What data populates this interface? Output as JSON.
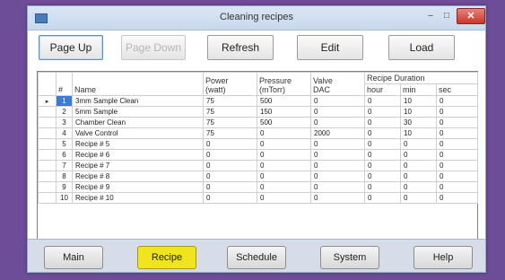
{
  "window": {
    "title": "Cleaning recipes",
    "minimize": "–",
    "maximize": "□",
    "close": "✕"
  },
  "toolbar": {
    "page_up": "Page Up",
    "page_down": "Page Down",
    "refresh": "Refresh",
    "edit": "Edit",
    "load": "Load"
  },
  "table": {
    "headers": {
      "num": "#",
      "name": "Name",
      "power": "Power",
      "power_unit": "(watt)",
      "pressure": "Pressure",
      "pressure_unit": "(mTorr)",
      "valve": "Valve",
      "valve_unit": "DAC",
      "duration": "Recipe Duration",
      "hour": "hour",
      "min": "min",
      "sec": "sec"
    },
    "current_row_marker": "▸",
    "rows": [
      {
        "num": "1",
        "name": "3mm Sample Clean",
        "power": "75",
        "pressure": "500",
        "valve": "0",
        "hour": "0",
        "min": "10",
        "sec": "0"
      },
      {
        "num": "2",
        "name": "5mm Sample",
        "power": "75",
        "pressure": "150",
        "valve": "0",
        "hour": "0",
        "min": "10",
        "sec": "0"
      },
      {
        "num": "3",
        "name": "Chamber Clean",
        "power": "75",
        "pressure": "500",
        "valve": "0",
        "hour": "0",
        "min": "30",
        "sec": "0"
      },
      {
        "num": "4",
        "name": "Valve Control",
        "power": "75",
        "pressure": "0",
        "valve": "2000",
        "hour": "0",
        "min": "10",
        "sec": "0"
      },
      {
        "num": "5",
        "name": "Recipe # 5",
        "power": "0",
        "pressure": "0",
        "valve": "0",
        "hour": "0",
        "min": "0",
        "sec": "0"
      },
      {
        "num": "6",
        "name": "Recipe # 6",
        "power": "0",
        "pressure": "0",
        "valve": "0",
        "hour": "0",
        "min": "0",
        "sec": "0"
      },
      {
        "num": "7",
        "name": "Recipe # 7",
        "power": "0",
        "pressure": "0",
        "valve": "0",
        "hour": "0",
        "min": "0",
        "sec": "0"
      },
      {
        "num": "8",
        "name": "Recipe # 8",
        "power": "0",
        "pressure": "0",
        "valve": "0",
        "hour": "0",
        "min": "0",
        "sec": "0"
      },
      {
        "num": "9",
        "name": "Recipe # 9",
        "power": "0",
        "pressure": "0",
        "valve": "0",
        "hour": "0",
        "min": "0",
        "sec": "0"
      },
      {
        "num": "10",
        "name": "Recipe # 10",
        "power": "0",
        "pressure": "0",
        "valve": "0",
        "hour": "0",
        "min": "0",
        "sec": "0"
      }
    ]
  },
  "nav": {
    "main": "Main",
    "recipe": "Recipe",
    "schedule": "Schedule",
    "system": "System",
    "help": "Help",
    "active_color": "#f0e41f"
  }
}
